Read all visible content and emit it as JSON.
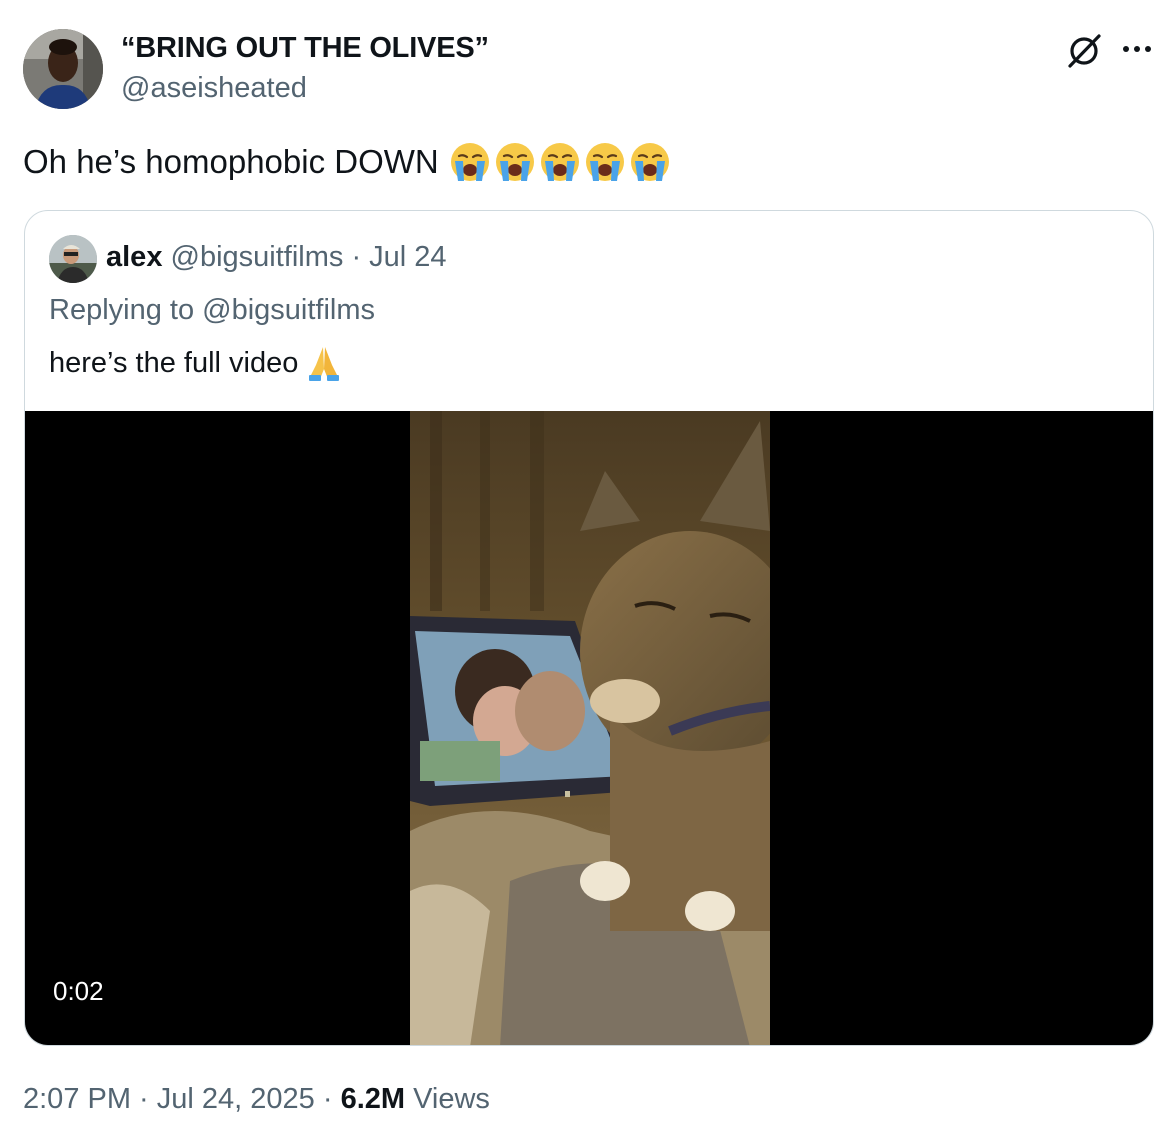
{
  "author": {
    "display_name": "“BRING OUT THE OLIVES”",
    "handle": "@aseisheated"
  },
  "tweet": {
    "text": "Oh he’s homophobic DOWN",
    "emoji_names": [
      "loudly-crying-face",
      "loudly-crying-face",
      "loudly-crying-face",
      "loudly-crying-face",
      "loudly-crying-face"
    ]
  },
  "quoted": {
    "name": "alex",
    "handle_date": "@bigsuitfilms · Jul 24",
    "replying": "Replying to @bigsuitfilms",
    "text": "here’s the full video",
    "emoji_name": "folded-hands",
    "video_timestamp": "0:02"
  },
  "footer": {
    "time_date": "2:07 PM · Jul 24, 2025 · ",
    "views_count": "6.2M",
    "views_label": " Views"
  },
  "icons": {
    "grok": "grok-icon",
    "more": "more-icon"
  },
  "colors": {
    "text": "#0f1419",
    "secondary": "#536471",
    "border": "#cfd9de"
  }
}
